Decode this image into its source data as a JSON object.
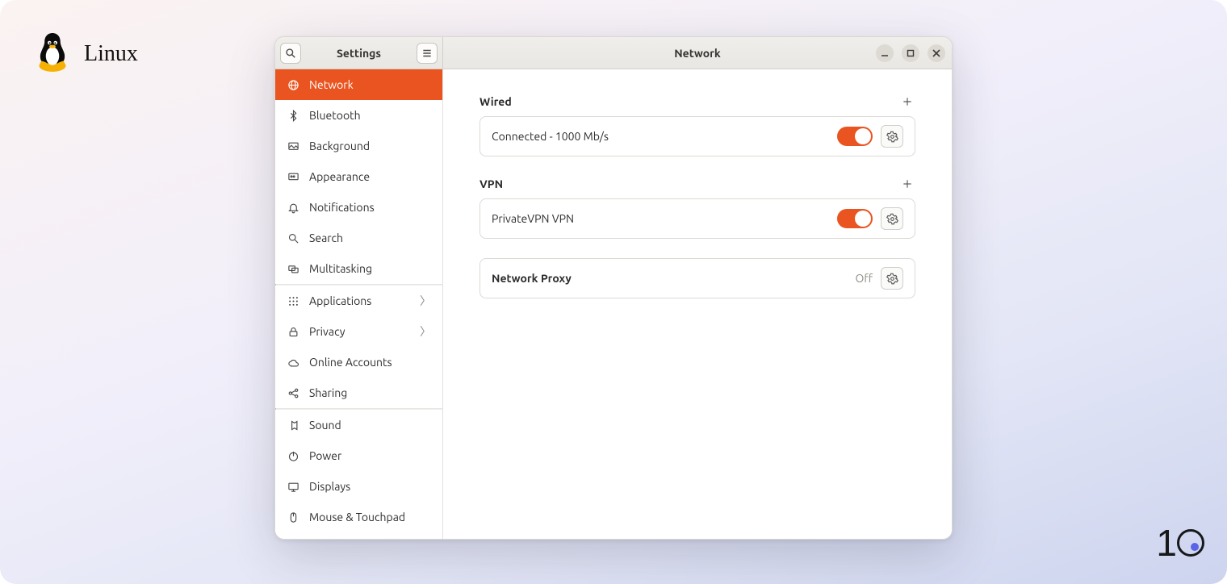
{
  "page_label": "Linux",
  "titlebar": {
    "left_title": "Settings",
    "right_title": "Network"
  },
  "sidebar": {
    "items": [
      {
        "label": "Network",
        "icon": "globe"
      },
      {
        "label": "Bluetooth",
        "icon": "bluetooth"
      },
      {
        "label": "Background",
        "icon": "background"
      },
      {
        "label": "Appearance",
        "icon": "appearance"
      },
      {
        "label": "Notifications",
        "icon": "bell"
      },
      {
        "label": "Search",
        "icon": "search"
      },
      {
        "label": "Multitasking",
        "icon": "multitask"
      },
      {
        "label": "Applications",
        "icon": "apps"
      },
      {
        "label": "Privacy",
        "icon": "lock"
      },
      {
        "label": "Online Accounts",
        "icon": "cloud"
      },
      {
        "label": "Sharing",
        "icon": "share"
      },
      {
        "label": "Sound",
        "icon": "sound"
      },
      {
        "label": "Power",
        "icon": "power"
      },
      {
        "label": "Displays",
        "icon": "display"
      },
      {
        "label": "Mouse & Touchpad",
        "icon": "mouse"
      }
    ]
  },
  "sections": {
    "wired": {
      "heading": "Wired",
      "status": "Connected - 1000 Mb/s"
    },
    "vpn": {
      "heading": "VPN",
      "name": "PrivateVPN VPN"
    },
    "proxy": {
      "label": "Network Proxy",
      "status": "Off"
    }
  },
  "colors": {
    "accent": "#e95420"
  }
}
